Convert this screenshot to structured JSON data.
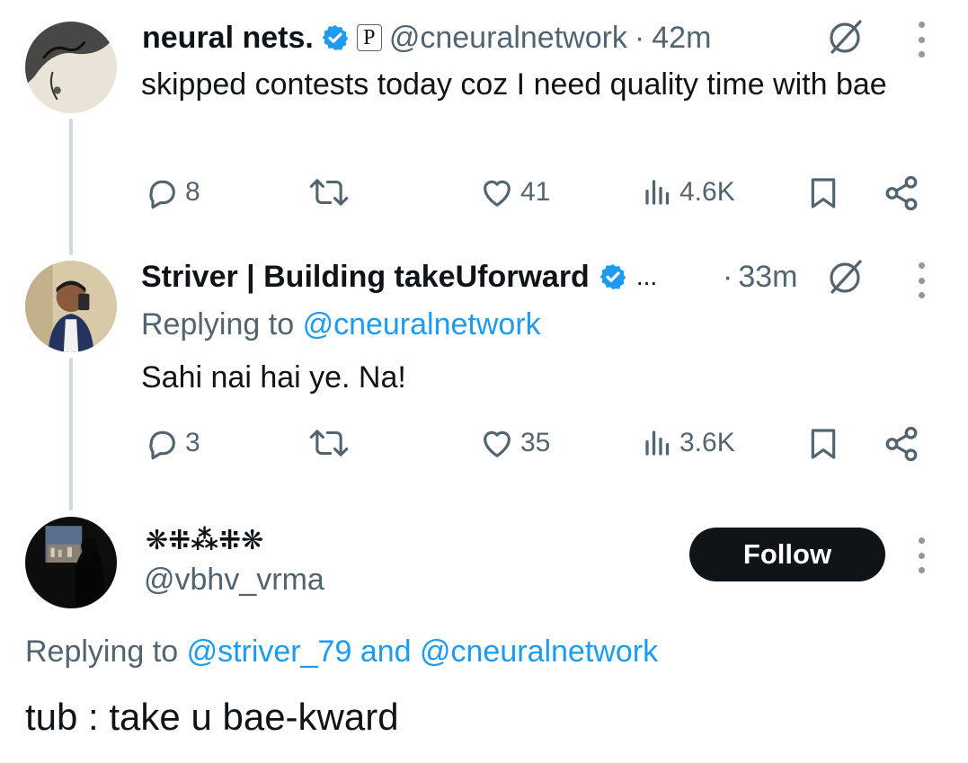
{
  "tweets": [
    {
      "name": "neural nets.",
      "badge": "P",
      "handle": "@cneuralnetwork",
      "separator": "·",
      "time": "42m",
      "text": "skipped contests today coz I need quality time with bae",
      "stats": {
        "replies": "8",
        "likes": "41",
        "views": "4.6K"
      }
    },
    {
      "name": "Striver | Building takeUforward",
      "truncation": "...",
      "separator": "·",
      "time": "33m",
      "replying_prefix": "Replying to",
      "replying_handle": "@cneuralnetwork",
      "text": "Sahi nai hai ye. Na!",
      "stats": {
        "replies": "3",
        "likes": "35",
        "views": "3.6K"
      }
    },
    {
      "name": "❋⁜⁂⁜❋",
      "handle": "@vbhv_vrma",
      "follow_label": "Follow",
      "replying_prefix": "Replying to",
      "replying_handle_1": "@striver_79",
      "replying_and": "and",
      "replying_handle_2": "@cneuralnetwork",
      "text": "tub : take u bae-kward"
    }
  ],
  "colors": {
    "accent": "#1d9bf0",
    "text": "#0f1419",
    "muted": "#536471",
    "line": "#cfd9de"
  }
}
